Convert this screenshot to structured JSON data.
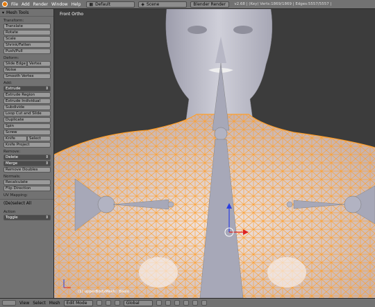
{
  "header": {
    "menus": [
      "File",
      "Add",
      "Render",
      "Window",
      "Help"
    ],
    "layout": "Default",
    "scene": "Scene",
    "engine": "Blender Render",
    "stats": "v2.68 | (Key) Verts:1869/1869 | Edges:5557/5557 |"
  },
  "tool_panel": {
    "title": "Mesh Tools",
    "transform": {
      "heading": "Transform:",
      "buttons": [
        "Translate",
        "Rotate",
        "Scale",
        "Shrink/Fatten",
        "Push/Pull"
      ]
    },
    "deform": {
      "heading": "Deform:",
      "slide_edge": "Slide Edge",
      "vertex": "Vertex",
      "noise": "Noise",
      "smooth_vertex": "Smooth Vertex"
    },
    "add": {
      "heading": "Add:",
      "extrude_select": "Extrude",
      "buttons": [
        "Extrude Region",
        "Extrude Individual",
        "Subdivide",
        "Loop Cut and Slide",
        "Duplicate",
        "Spin",
        "Screw"
      ],
      "knife": "Knife",
      "select": "Select",
      "knife_project": "Knife Project"
    },
    "remove": {
      "heading": "Remove:",
      "delete": "Delete",
      "merge": "Merge",
      "remove_doubles": "Remove Doubles"
    },
    "normals": {
      "heading": "Normals:",
      "recalculate": "Recalculate",
      "flip_direction": "Flip Direction"
    },
    "uv_mapping": {
      "heading": "UV Mapping:"
    },
    "deselect": {
      "title": "(De)select All",
      "action_label": "Action",
      "action_value": "Toggle"
    }
  },
  "viewport": {
    "view_label": "Front Ortho",
    "object_label": "(1) upperBodyMesh : Basis"
  },
  "footer": {
    "menus": [
      "View",
      "Select",
      "Mesh"
    ],
    "mode": "Edit Mode",
    "orientation": "Global"
  },
  "colors": {
    "selection": "#ff9f2a",
    "skin_light": "#e9d9d2",
    "head": "#b9b9c6",
    "bone": "#a7a8b8"
  },
  "icons": [
    "blender-logo-icon",
    "layout-icon",
    "scene-icon",
    "axis-icon",
    "viewport-shading-icon",
    "pivot-icon",
    "manipulator-icon",
    "vertex-select-icon",
    "edge-select-icon",
    "face-select-icon"
  ]
}
